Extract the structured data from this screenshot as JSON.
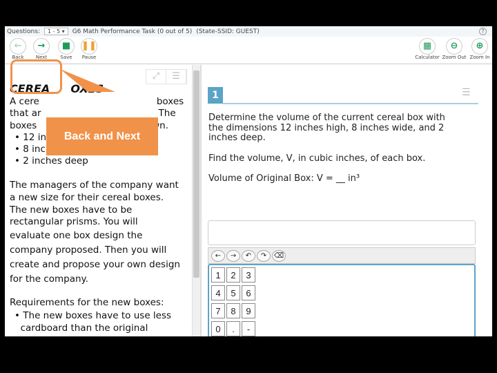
{
  "topbar": {
    "questions_label": "Questions:",
    "questions_value": "1 - 5",
    "test_title": "G6 Math Performance Task (0 out of 5)",
    "student": "(State-SSID: GUEST)",
    "help": "?"
  },
  "toolbar": {
    "back": "Back",
    "next": "Next",
    "save": "Save",
    "pause": "Pause",
    "calculator": "Calculator",
    "zoom_out": "Zoom Out",
    "zoom_in": "Zoom In"
  },
  "accent": "#5ba3c7",
  "callout_color": "#f0924a",
  "passage": {
    "title_a": "CEREA",
    "title_b": "OXES",
    "l1a": "A cere",
    "l1b": "boxes",
    "l2a": "that ar",
    "l2b": "The",
    "l3a": "boxes",
    "l3b": "hown.",
    "dims": [
      "12 inches high",
      "8 inches wide",
      "2 inches deep"
    ],
    "para": [
      "The managers of the company want",
      "a new size for their cereal boxes.",
      "The new boxes have to be",
      "rectangular prisms. You will",
      "evaluate one box design the",
      "company proposed. Then you will",
      "create and propose your own design",
      "for the company."
    ],
    "req_title": "Requirements for the new boxes:",
    "req_items": [
      "The new boxes have to use less",
      "cardboard than the original"
    ]
  },
  "question": {
    "number": "1",
    "lines": [
      "Determine the volume of the current cereal box with",
      "the dimensions 12 inches high, 8 inches wide, and 2",
      "inches deep."
    ],
    "find": "Find the volume, V, in cubic inches, of each box.",
    "prompt": "Volume of Original Box: V = __ in³",
    "answer": ""
  },
  "keypad": [
    "1",
    "2",
    "3",
    "4",
    "5",
    "6",
    "7",
    "8",
    "9",
    "0",
    ".",
    "-"
  ],
  "callout": {
    "text": "Back and Next"
  }
}
